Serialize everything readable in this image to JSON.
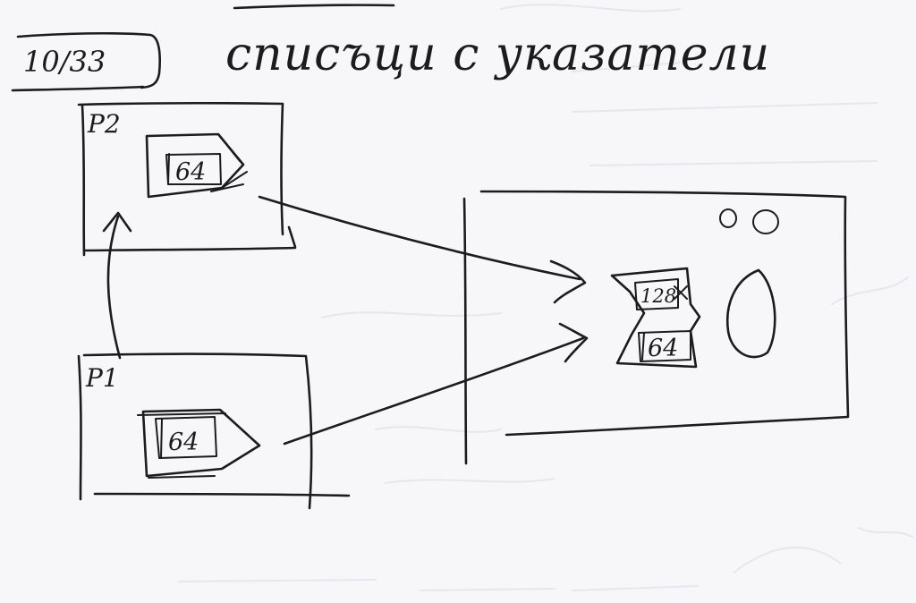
{
  "page_label": "10/33",
  "title": "списъци с указатели",
  "process_top": {
    "label": "P2",
    "value": "64"
  },
  "process_bottom": {
    "label": "P1",
    "value": "64"
  },
  "shared_region": {
    "upper_value": "128",
    "lower_value": "64"
  }
}
